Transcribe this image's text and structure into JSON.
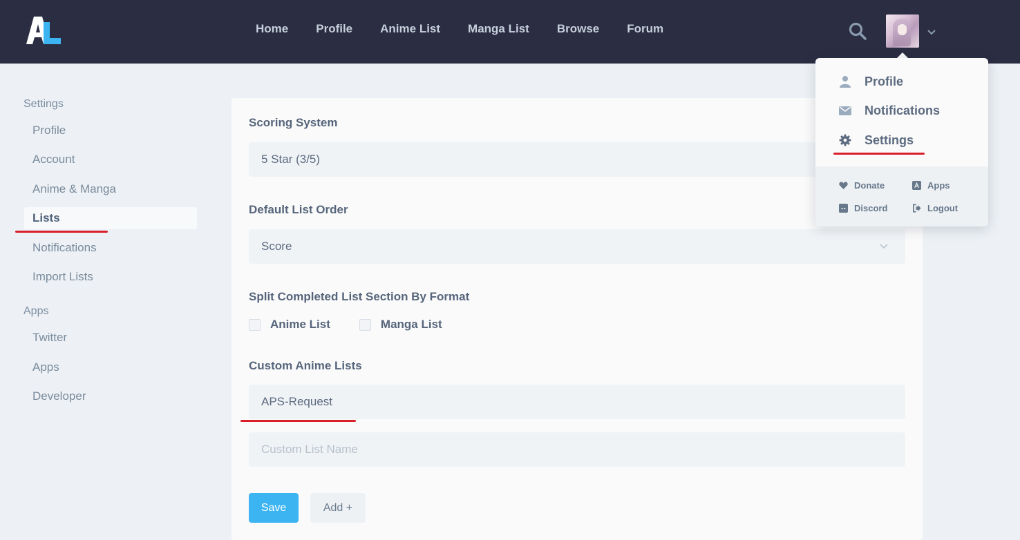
{
  "nav": {
    "links": [
      "Home",
      "Profile",
      "Anime List",
      "Manga List",
      "Browse",
      "Forum"
    ]
  },
  "sidebar": {
    "settings_section": "Settings",
    "settings_items": [
      "Profile",
      "Account",
      "Anime & Manga",
      "Lists",
      "Notifications",
      "Import Lists"
    ],
    "active_item": "Lists",
    "apps_section": "Apps",
    "apps_items": [
      "Twitter",
      "Apps",
      "Developer"
    ]
  },
  "form": {
    "scoring_label": "Scoring System",
    "scoring_value": "5 Star (3/5)",
    "order_label": "Default List Order",
    "order_value": "Score",
    "split_label": "Split Completed List Section By Format",
    "split_options": [
      "Anime List",
      "Manga List"
    ],
    "custom_label": "Custom Anime Lists",
    "custom_lists": [
      "APS-Request"
    ],
    "custom_placeholder": "Custom List Name",
    "save_label": "Save",
    "add_label": "Add +"
  },
  "dropdown": {
    "items": [
      "Profile",
      "Notifications",
      "Settings"
    ],
    "footer": [
      "Donate",
      "Apps",
      "Discord",
      "Logout"
    ]
  },
  "colors": {
    "nav_bg": "#2b2d42",
    "accent": "#3db4f2",
    "annotation": "#d9202a",
    "page_bg": "#edf1f5"
  }
}
